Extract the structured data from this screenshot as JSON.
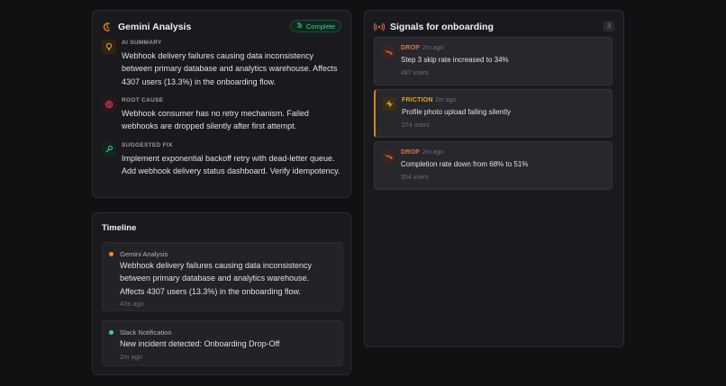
{
  "analysis": {
    "title": "Gemini Analysis",
    "status": "Complete",
    "sections": [
      {
        "label": "AI SUMMARY",
        "text": "Webhook delivery failures causing data inconsistency between primary database and analytics warehouse. Affects 4307 users (13.3%) in the onboarding flow.",
        "icon": "lightbulb-icon",
        "color": "#e0a431"
      },
      {
        "label": "ROOT CAUSE",
        "text": "Webhook consumer has no retry mechanism. Failed webhooks are dropped silently after first attempt.",
        "icon": "target-icon",
        "color": "#e0465f"
      },
      {
        "label": "SUGGESTED FIX",
        "text": "Implement exponential backoff retry with dead-letter queue. Add webhook delivery status dashboard. Verify idempotency.",
        "icon": "wrench-icon",
        "color": "#3fcf8e"
      }
    ]
  },
  "timeline": {
    "title": "Timeline",
    "items": [
      {
        "source": "Gemini Analysis",
        "message": "Webhook delivery failures causing data inconsistency between primary database and analytics warehouse. Affects 4307 users (13.3%) in the onboarding flow.",
        "time": "43s ago",
        "color": "#f08a24"
      },
      {
        "source": "Slack Notification",
        "message": "New incident detected: Onboarding Drop-Off",
        "time": "2m ago",
        "color": "#3fcf8e"
      }
    ]
  },
  "signals": {
    "title": "Signals for onboarding",
    "count": "3",
    "items": [
      {
        "type": "DROP",
        "age": "2m ago",
        "title": "Step 3 skip rate increased to 34%",
        "users": "487 users",
        "color": "#e0724a",
        "icon": "trend-down-icon"
      },
      {
        "type": "FRICTION",
        "age": "2m ago",
        "title": "Profile photo upload failing silently",
        "users": "274 users",
        "color": "#e0a431",
        "icon": "friction-icon"
      },
      {
        "type": "DROP",
        "age": "2m ago",
        "title": "Completion rate down from 68% to 51%",
        "users": "354 users",
        "color": "#e0724a",
        "icon": "trend-down-icon"
      }
    ]
  }
}
